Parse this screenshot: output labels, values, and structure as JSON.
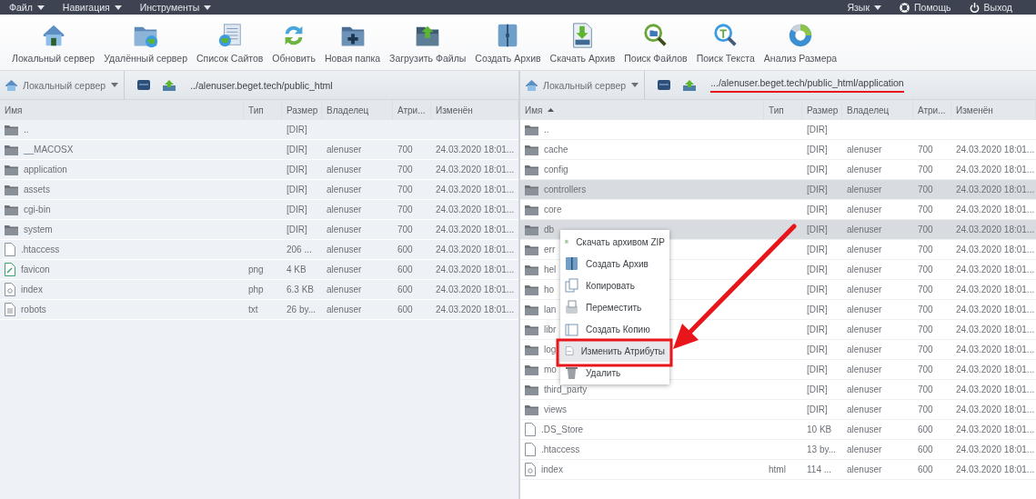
{
  "menubar": {
    "left": [
      {
        "label": "Файл"
      },
      {
        "label": "Навигация"
      },
      {
        "label": "Инструменты"
      }
    ],
    "right": [
      {
        "label": "Язык",
        "kind": "dropdown"
      },
      {
        "label": "Помощь",
        "kind": "help"
      },
      {
        "label": "Выход",
        "kind": "logout"
      }
    ]
  },
  "toolbar": [
    {
      "label": "Локальный сервер"
    },
    {
      "label": "Удалённый сервер"
    },
    {
      "label": "Список Сайтов"
    },
    {
      "label": "Обновить"
    },
    {
      "label": "Новая папка"
    },
    {
      "label": "Загрузить Файлы"
    },
    {
      "label": "Создать Архив"
    },
    {
      "label": "Скачать Архив"
    },
    {
      "label": "Поиск Файлов"
    },
    {
      "label": "Поиск Текста"
    },
    {
      "label": "Анализ Размера"
    }
  ],
  "panels": [
    {
      "server": "Локальный сервер",
      "path": "../alenuser.beget.tech/public_html",
      "underlined": false,
      "columns": [
        {
          "label": "Имя",
          "sorted": false
        },
        {
          "label": "Тип",
          "sorted": false
        },
        {
          "label": "Размер",
          "sorted": false
        },
        {
          "label": "Владелец",
          "sorted": false
        },
        {
          "label": "Атри...",
          "sorted": false
        },
        {
          "label": "Изменён",
          "sorted": false
        }
      ],
      "rows": [
        {
          "name": "..",
          "kind": "folder",
          "size": "[DIR]",
          "selected": false
        },
        {
          "name": "__MACOSX",
          "kind": "folder",
          "size": "[DIR]",
          "owner": "alenuser",
          "attrs": "700",
          "modified": "24.03.2020 18:01...",
          "selected": false
        },
        {
          "name": "application",
          "kind": "folder",
          "size": "[DIR]",
          "owner": "alenuser",
          "attrs": "700",
          "modified": "24.03.2020 18:01...",
          "selected": false
        },
        {
          "name": "assets",
          "kind": "folder",
          "size": "[DIR]",
          "owner": "alenuser",
          "attrs": "700",
          "modified": "24.03.2020 18:01...",
          "selected": false
        },
        {
          "name": "cgi-bin",
          "kind": "folder",
          "size": "[DIR]",
          "owner": "alenuser",
          "attrs": "700",
          "modified": "24.03.2020 18:01...",
          "selected": false
        },
        {
          "name": "system",
          "kind": "folder",
          "size": "[DIR]",
          "owner": "alenuser",
          "attrs": "700",
          "modified": "24.03.2020 18:01...",
          "selected": false
        },
        {
          "name": ".htaccess",
          "kind": "file",
          "size": "206 ...",
          "owner": "alenuser",
          "attrs": "600",
          "modified": "24.03.2020 18:01...",
          "selected": false
        },
        {
          "name": "favicon",
          "kind": "image",
          "type": "png",
          "size": "4 KB",
          "owner": "alenuser",
          "attrs": "600",
          "modified": "24.03.2020 18:01...",
          "selected": false
        },
        {
          "name": "index",
          "kind": "script",
          "type": "php",
          "size": "6.3 KB",
          "owner": "alenuser",
          "attrs": "600",
          "modified": "24.03.2020 18:01...",
          "selected": false
        },
        {
          "name": "robots",
          "kind": "text",
          "type": "txt",
          "size": "26 by...",
          "owner": "alenuser",
          "attrs": "600",
          "modified": "24.03.2020 18:01...",
          "selected": false
        }
      ]
    },
    {
      "server": "Локальный сервер",
      "path": ".../alenuser.beget.tech/public_html/application",
      "underlined": true,
      "columns": [
        {
          "label": "Имя",
          "sorted": true
        },
        {
          "label": "Тип",
          "sorted": false
        },
        {
          "label": "Размер",
          "sorted": false
        },
        {
          "label": "Владелец",
          "sorted": false
        },
        {
          "label": "Атри...",
          "sorted": false
        },
        {
          "label": "Изменён",
          "sorted": false
        }
      ],
      "rows": [
        {
          "name": "..",
          "kind": "folder",
          "size": "[DIR]",
          "selected": false
        },
        {
          "name": "cache",
          "kind": "folder",
          "size": "[DIR]",
          "owner": "alenuser",
          "attrs": "700",
          "modified": "24.03.2020 18:01...",
          "selected": false
        },
        {
          "name": "config",
          "kind": "folder",
          "size": "[DIR]",
          "owner": "alenuser",
          "attrs": "700",
          "modified": "24.03.2020 18:01...",
          "selected": false
        },
        {
          "name": "controllers",
          "kind": "folder",
          "size": "[DIR]",
          "owner": "alenuser",
          "attrs": "700",
          "modified": "24.03.2020 18:01...",
          "selected": true
        },
        {
          "name": "core",
          "kind": "folder",
          "size": "[DIR]",
          "owner": "alenuser",
          "attrs": "700",
          "modified": "24.03.2020 18:01...",
          "selected": false
        },
        {
          "name": "db",
          "kind": "folder",
          "size": "[DIR]",
          "owner": "alenuser",
          "attrs": "700",
          "modified": "24.03.2020 18:01...",
          "selected": true
        },
        {
          "name": "err",
          "kind": "folder",
          "size": "[DIR]",
          "owner": "alenuser",
          "attrs": "700",
          "modified": "24.03.2020 18:01...",
          "selected": false
        },
        {
          "name": "hel",
          "kind": "folder",
          "size": "[DIR]",
          "owner": "alenuser",
          "attrs": "700",
          "modified": "24.03.2020 18:01...",
          "selected": false
        },
        {
          "name": "ho",
          "kind": "folder",
          "size": "[DIR]",
          "owner": "alenuser",
          "attrs": "700",
          "modified": "24.03.2020 18:01...",
          "selected": false
        },
        {
          "name": "lan",
          "kind": "folder",
          "size": "[DIR]",
          "owner": "alenuser",
          "attrs": "700",
          "modified": "24.03.2020 18:01...",
          "selected": false
        },
        {
          "name": "libr",
          "kind": "folder",
          "size": "[DIR]",
          "owner": "alenuser",
          "attrs": "700",
          "modified": "24.03.2020 18:01...",
          "selected": false
        },
        {
          "name": "log",
          "kind": "folder",
          "size": "[DIR]",
          "owner": "alenuser",
          "attrs": "700",
          "modified": "24.03.2020 18:01...",
          "selected": false
        },
        {
          "name": "mo",
          "kind": "folder",
          "size": "[DIR]",
          "owner": "alenuser",
          "attrs": "700",
          "modified": "24.03.2020 18:01...",
          "selected": false
        },
        {
          "name": "third_party",
          "kind": "folder",
          "size": "[DIR]",
          "owner": "alenuser",
          "attrs": "700",
          "modified": "24.03.2020 18:01...",
          "selected": false
        },
        {
          "name": "views",
          "kind": "folder",
          "size": "[DIR]",
          "owner": "alenuser",
          "attrs": "700",
          "modified": "24.03.2020 18:01...",
          "selected": false
        },
        {
          "name": ".DS_Store",
          "kind": "file",
          "size": "10 KB",
          "owner": "alenuser",
          "attrs": "600",
          "modified": "24.03.2020 18:01...",
          "selected": false
        },
        {
          "name": ".htaccess",
          "kind": "file",
          "size": "13 by...",
          "owner": "alenuser",
          "attrs": "600",
          "modified": "24.03.2020 18:01...",
          "selected": false
        },
        {
          "name": "index",
          "kind": "script",
          "type": "html",
          "size": "114 ...",
          "owner": "alenuser",
          "attrs": "600",
          "modified": "24.03.2020 18:01...",
          "selected": false
        }
      ]
    }
  ],
  "context_menu": {
    "items": [
      {
        "label": "Скачать архивом ZIP",
        "selected": false
      },
      {
        "label": "Создать Архив",
        "selected": false
      },
      {
        "label": "Копировать",
        "selected": false
      },
      {
        "label": "Переместить",
        "selected": false
      },
      {
        "label": "Создать Копию",
        "selected": false
      },
      {
        "label": "Изменить Атрибуты",
        "selected": true
      },
      {
        "label": "Удалить",
        "selected": false
      }
    ]
  }
}
